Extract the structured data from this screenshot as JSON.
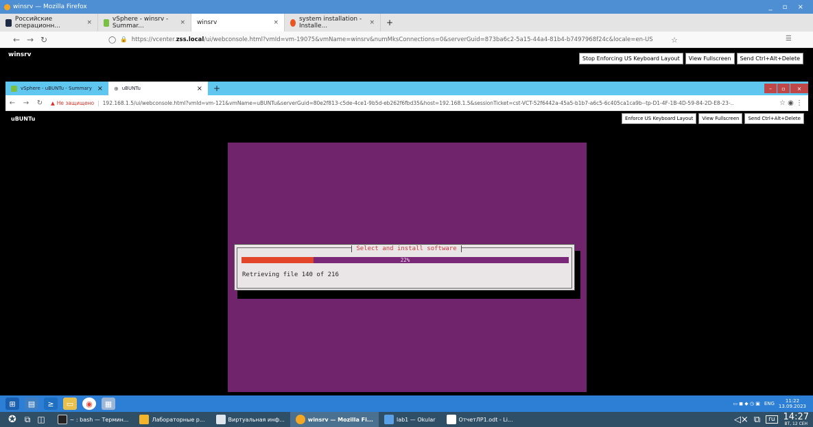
{
  "outer_window": {
    "title": "winsrv — Mozilla Firefox",
    "controls": "_ ▫ ×"
  },
  "outer_tabs": [
    {
      "label": "Российские операционн..."
    },
    {
      "label": "vSphere - winsrv - Summar..."
    },
    {
      "label": "winsrv"
    },
    {
      "label": "system installation - Installe..."
    }
  ],
  "outer_new_tab": "+",
  "outer_url": {
    "prefix": "https://vcenter.",
    "domain": "zss.local",
    "path": "/ui/webconsole.html?vmId=vm-19075&vmName=winsrv&numMksConnections=0&serverGuid=873ba6c2-5a15-44a4-81b4-b7497968f24c&locale=en-US"
  },
  "vm1": {
    "title": "winsrv",
    "buttons": [
      "Stop Enforcing US Keyboard Layout",
      "View Fullscreen",
      "Send Ctrl+Alt+Delete"
    ]
  },
  "inner_tabs": [
    {
      "label": "vSphere - uBUNTu - Summary"
    },
    {
      "label": "uBUNTu"
    }
  ],
  "inner_url": {
    "warning": "Не защищено",
    "text": "192.168.1.5/ui/webconsole.html?vmId=vm-121&vmName=uBUNTu&serverGuid=80e2f813-c5de-4ce1-9b5d-eb262f6fbd35&host=192.168.1.5&sessionTicket=cst-VCT-52f6442a-45a5-b1b7-a6c5-6c405ca1ca9b--tp-D1-4F-1B-4D-59-84-2D-E8-23-..."
  },
  "vm2": {
    "title": "uBUNTu",
    "buttons": [
      "Enforce US Keyboard Layout",
      "View Fullscreen",
      "Send Ctrl+Alt+Delete"
    ]
  },
  "installer": {
    "dialog_title": "Select and install software",
    "progress": 0.22,
    "progress_label": "22%",
    "status": "Retrieving file 140 of 216"
  },
  "inner_tray": {
    "lang": "ENG",
    "time": "11:22",
    "date": "13.09.2023"
  },
  "outer_taskbar": {
    "tasks": [
      {
        "label": "~ : bash — Термин..."
      },
      {
        "label": "Лабораторные р..."
      },
      {
        "label": "Виртуальная инф..."
      },
      {
        "label": "winsrv — Mozilla Fi..."
      },
      {
        "label": "lab1 — Okular"
      },
      {
        "label": "ОтчетЛР1.odt - Li..."
      }
    ],
    "lang": "ru",
    "time": "14:27",
    "date": "ВТ, 12 СЕН"
  },
  "colors": {
    "ubuntu_purple": "#6f246b",
    "progress_orange": "#e2452a",
    "kde_blue": "#2c7fd5"
  }
}
